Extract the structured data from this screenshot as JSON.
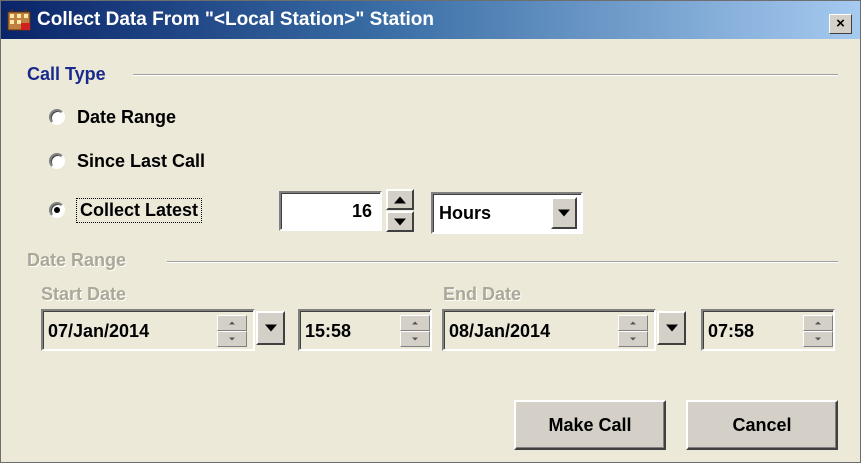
{
  "window": {
    "title": "Collect Data From \"<Local Station>\" Station",
    "close_label": "×"
  },
  "call_type": {
    "group_label": "Call Type",
    "options": [
      {
        "label": "Date Range",
        "checked": false
      },
      {
        "label": "Since Last Call",
        "checked": false
      },
      {
        "label": "Collect Latest",
        "checked": true
      }
    ],
    "latest_value": "16",
    "latest_unit": "Hours"
  },
  "date_range": {
    "group_label": "Date Range",
    "start_label": "Start Date",
    "start_date": "07/Jan/2014",
    "start_time": "15:58",
    "end_label": "End Date",
    "end_date": "08/Jan/2014",
    "end_time": "07:58"
  },
  "buttons": {
    "make_call": "Make Call",
    "cancel": "Cancel"
  },
  "colors": {
    "title_accent": "#0a246a",
    "group_label_active": "#1a2a8c",
    "disabled_text": "#aca899"
  }
}
